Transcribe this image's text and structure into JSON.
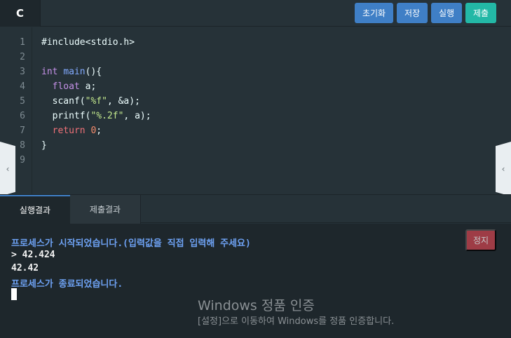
{
  "toolbar": {
    "language": "C",
    "reset_label": "초기화",
    "save_label": "저장",
    "run_label": "실행",
    "submit_label": "제출"
  },
  "editor": {
    "line_numbers": [
      "1",
      "2",
      "3",
      "4",
      "5",
      "6",
      "7",
      "8",
      "9"
    ],
    "code": {
      "l1": "#include<stdio.h>",
      "l3_kw": "int",
      "l3_fn": "main",
      "l3_rest": "(){",
      "l4_kw": "float",
      "l4_rest": " a;",
      "l5_fn": "scanf(",
      "l5_str": "\"%f\"",
      "l5_rest": ", &a);",
      "l6_fn": "printf(",
      "l6_str": "\"%.2f\"",
      "l6_rest": ", a);",
      "l7_kw": "return",
      "l7_num": "0",
      "l7_rest": ";",
      "l8": "}"
    }
  },
  "side_handles": {
    "left_glyph": "‹",
    "right_glyph": "‹"
  },
  "tabs": {
    "result_label": "실행결과",
    "submit_result_label": "제출결과"
  },
  "console": {
    "lines": [
      "프로세스가 시작되었습니다.(입력값을 직접 입력해 주세요)",
      "> 42.424",
      "42.42",
      "프로세스가 종료되었습니다."
    ],
    "stop_label": "정지"
  },
  "watermark": {
    "title": "Windows 정품 인증",
    "subtitle": "[설정]으로 이동하여 Windows를 정품 인증합니다."
  },
  "colors": {
    "background": "#263238",
    "console_bg": "#1e272c",
    "primary_button": "#3f7fc6",
    "submit_button": "#23b8a6",
    "stop_button": "#c9434f",
    "console_info_text": "#6ea2f4"
  }
}
